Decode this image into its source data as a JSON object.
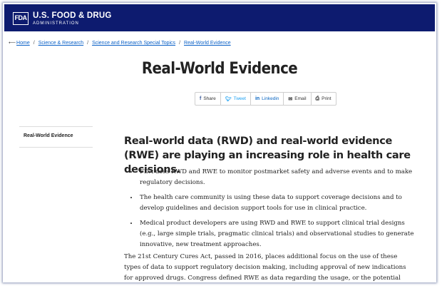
{
  "header": {
    "logo_mark": "FDA",
    "agency_name": "U.S. FOOD & DRUG",
    "agency_sub": "ADMINISTRATION",
    "bg_color": "#0d1b6f"
  },
  "breadcrumb": {
    "items": [
      "Home",
      "Science & Research",
      "Science and Research Special Topics",
      "Real-World Evidence"
    ],
    "separator": "/",
    "back_icon": "left-arrow-icon"
  },
  "page_title": "Real-World Evidence",
  "share": {
    "buttons": [
      {
        "label": "Share",
        "icon": "facebook-icon"
      },
      {
        "label": "Tweet",
        "icon": "twitter-icon"
      },
      {
        "label": "Linkedin",
        "icon": "linkedin-icon"
      },
      {
        "label": "Email",
        "icon": "envelope-icon"
      },
      {
        "label": "Print",
        "icon": "printer-icon"
      }
    ]
  },
  "sidebar": {
    "items": [
      {
        "label": "Real-World Evidence"
      }
    ]
  },
  "main": {
    "lead": "Real-world data (RWD) and real-world evidence (RWE) are playing an increasing role in health care decisions.",
    "bullets": [
      "FDA uses RWD and RWE to monitor postmarket safety and adverse events and to make regulatory decisions.",
      "The health care community is using these data to support coverage decisions and to develop guidelines and decision support tools for use in clinical practice.",
      "Medical product developers are using RWD and RWE to support clinical trial designs (e.g., large simple trials, pragmatic clinical trials) and observational studies to generate innovative, new treatment approaches."
    ],
    "paragraph": "The 21st Century Cures Act, passed in 2016, places additional focus on the use of these types of data to support regulatory decision making, including approval of new indications for approved drugs. Congress defined RWE as data regarding the usage, or the potential"
  }
}
